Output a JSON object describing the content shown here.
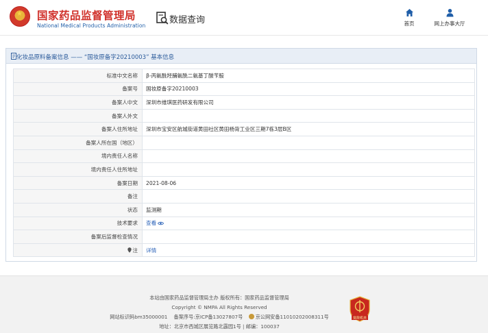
{
  "header": {
    "org_cn": "国家药品监督管理局",
    "org_en": "National Medical Products Administration",
    "data_query": "数据查询",
    "nav": [
      {
        "label": "首页",
        "icon": "home-icon"
      },
      {
        "label": "网上办事大厅",
        "icon": "user-icon"
      }
    ]
  },
  "panel": {
    "title": "化妆品原料备案信息 —— “国妆原备字20210003” 基本信息",
    "rows": [
      {
        "label": "标准中文名称",
        "value": "β-丙氨酰羟脯氨酰二氨基丁酸苄胺"
      },
      {
        "label": "备案号",
        "value": "国妆原备字20210003"
      },
      {
        "label": "备案人中文",
        "value": "深圳市维琪医药研发有限公司"
      },
      {
        "label": "备案人外文",
        "value": ""
      },
      {
        "label": "备案人住所地址",
        "value": "深圳市宝安区航城街道黄田社区黄田杨背工业区三期7栋3层B区"
      },
      {
        "label": "备案人所在国（地区）",
        "value": ""
      },
      {
        "label": "境内责任人名称",
        "value": ""
      },
      {
        "label": "境内责任人住所地址",
        "value": ""
      },
      {
        "label": "备案日期",
        "value": "2021-08-06"
      },
      {
        "label": "备注",
        "value": ""
      },
      {
        "label": "状态",
        "value": "监测期"
      },
      {
        "label": "技术要求",
        "value": "查看"
      },
      {
        "label": "备案后监督检查情况",
        "value": ""
      },
      {
        "label": "注",
        "value": "详情"
      }
    ]
  },
  "footer": {
    "line1": "本站由国家药品监督管理局主办 版权所有：国家药品监督管理局",
    "line2": "Copyright © NMPA All Rights Reserved",
    "line3a": "网站标识码bm35000001",
    "line3b": "备案序号:京ICP备13027807号",
    "line3c": "京公网安备11010202008311号",
    "line4": "地址：北京市西城区展览路北露园1号 | 邮编：100037",
    "badge_text": "党政机关"
  },
  "colors": {
    "brand_red": "#d0302a",
    "brand_blue": "#1f5ea8",
    "link": "#2a62b8",
    "panel_head_bg": "#e8eef6"
  }
}
